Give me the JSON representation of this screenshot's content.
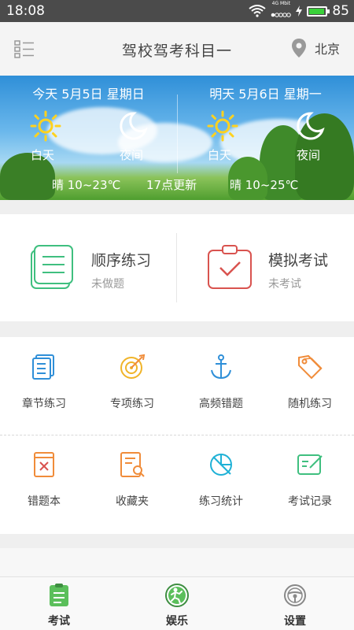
{
  "status_bar": {
    "time": "18:08",
    "network": "4G",
    "signal_caption": "Mbit",
    "battery": "85",
    "battery_level": 0.85,
    "battery_color": "#3ad13a"
  },
  "header": {
    "title": "驾校驾考科目一",
    "city": "北京",
    "menu_icon": "list-menu-icon",
    "location_icon": "location-pin-icon"
  },
  "weather": {
    "today": {
      "date": "今天 5月5日 星期日",
      "day_label": "白天",
      "night_label": "夜间",
      "temp": "晴 10~23℃"
    },
    "tomorrow": {
      "date": "明天 5月6日 星期一",
      "day_label": "白天",
      "night_label": "夜间",
      "temp": "晴 10~25℃"
    },
    "update_text": "17点更新"
  },
  "practice": [
    {
      "title": "顺序练习",
      "status": "未做题",
      "icon": "sequence-doc-icon",
      "color": "#3fbf7f"
    },
    {
      "title": "模拟考试",
      "status": "未考试",
      "icon": "clipboard-check-icon",
      "color": "#d9534f"
    }
  ],
  "grid": [
    {
      "label": "章节练习",
      "icon": "chapter-icon",
      "color": "#2f8fd8"
    },
    {
      "label": "专项练习",
      "icon": "target-icon",
      "color": "#f0b429"
    },
    {
      "label": "高频错题",
      "icon": "anchor-icon",
      "color": "#2f8fd8"
    },
    {
      "label": "随机练习",
      "icon": "tag-icon",
      "color": "#f08c3a"
    },
    {
      "label": "错题本",
      "icon": "wrong-book-icon",
      "color": "#f08c3a"
    },
    {
      "label": "收藏夹",
      "icon": "favorite-search-icon",
      "color": "#f08c3a"
    },
    {
      "label": "练习统计",
      "icon": "stats-chart-icon",
      "color": "#1fb1d6"
    },
    {
      "label": "考试记录",
      "icon": "exam-record-icon",
      "color": "#3fbf7f"
    }
  ],
  "tabs": [
    {
      "label": "考试",
      "icon": "exam-tab-icon",
      "color": "#5bbf5b"
    },
    {
      "label": "娱乐",
      "icon": "entertainment-tab-icon",
      "color": "#3e8e41"
    },
    {
      "label": "设置",
      "icon": "steering-wheel-icon",
      "color": "#888888"
    }
  ]
}
